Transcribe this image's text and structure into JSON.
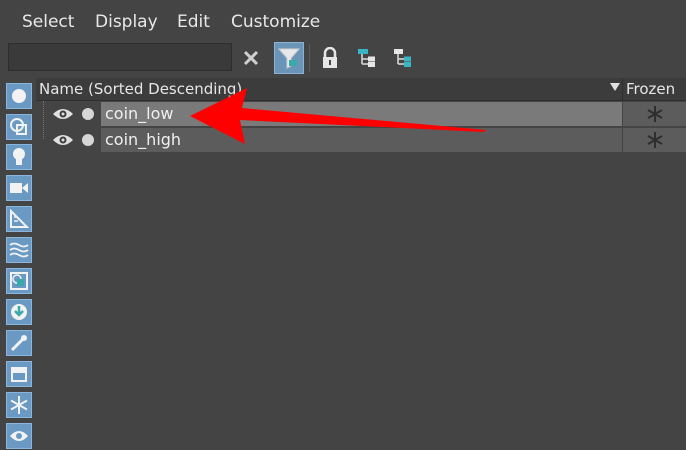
{
  "menu": {
    "items": [
      "Select",
      "Display",
      "Edit",
      "Customize"
    ]
  },
  "toolbar": {
    "search_value": "",
    "icons": [
      "close-icon",
      "filter-icon",
      "lock-icon",
      "hierarchy-icon",
      "hierarchy-alt-icon"
    ]
  },
  "sidebar": {
    "filters": [
      "geometry-filter",
      "shape-filter",
      "light-filter",
      "camera-filter",
      "helper-filter",
      "spacewarp-filter",
      "group-filter",
      "xref-filter",
      "bone-filter",
      "container-filter",
      "frozen-filter",
      "hidden-filter"
    ]
  },
  "header": {
    "name_label": "Name (Sorted Descending)",
    "frozen_label": "Frozen"
  },
  "rows": [
    {
      "name": "coin_low",
      "selected": true
    },
    {
      "name": "coin_high",
      "selected": false
    }
  ],
  "colors": {
    "accent": "#6a9ac4",
    "selected_row": "#7a7a7a",
    "row": "#5c5c5c",
    "annotation_arrow": "#ff0000"
  }
}
